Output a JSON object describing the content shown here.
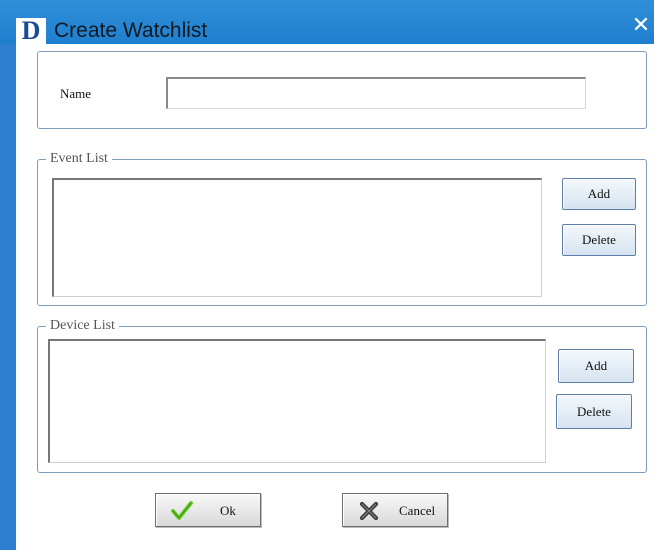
{
  "window": {
    "title": "Create Watchlist",
    "logo_letter": "D",
    "close_glyph": "✕"
  },
  "name_field": {
    "label": "Name",
    "value": ""
  },
  "event_list": {
    "legend": "Event List",
    "add_label": "Add",
    "delete_label": "Delete",
    "items": []
  },
  "device_list": {
    "legend": "Device List",
    "add_label": "Add",
    "delete_label": "Delete",
    "items": []
  },
  "footer": {
    "ok_label": "Ok",
    "cancel_label": "Cancel",
    "ok_icon": "checkmark-icon",
    "cancel_icon": "x-icon"
  },
  "colors": {
    "titlebar": "#2f8fd8",
    "group_border": "#7f9db9",
    "ok_icon": "#66cc22",
    "cancel_icon": "#444444"
  }
}
